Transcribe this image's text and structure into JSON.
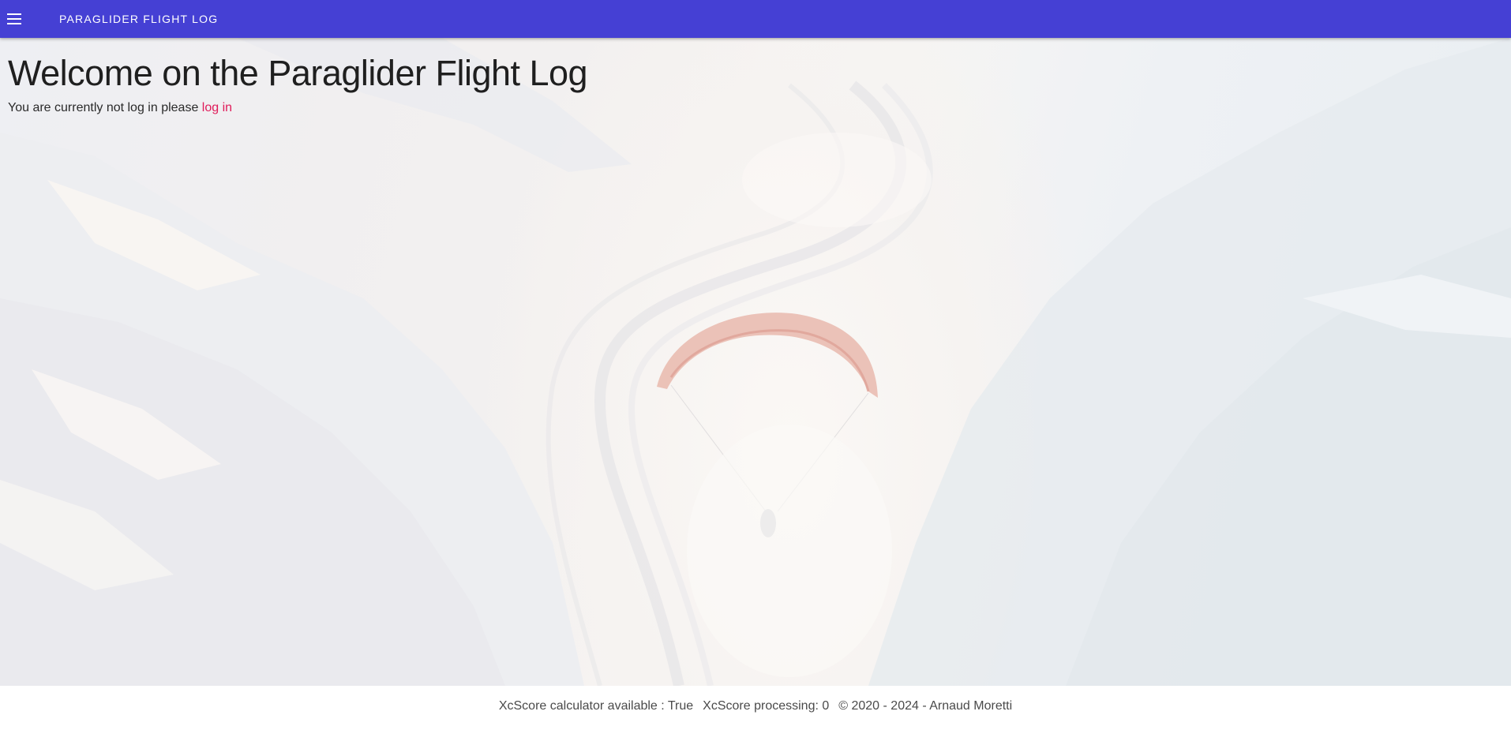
{
  "appbar": {
    "title": "Paraglider Flight Log",
    "menu_icon": "menu-icon",
    "color": "#4540d4"
  },
  "main": {
    "heading": "Welcome on the Paraglider Flight Log",
    "login_prompt": "You are currently not log in please",
    "login_link": "log in",
    "link_color": "#e01a59"
  },
  "footer": {
    "xcscore_available": "XcScore calculator available : True",
    "xcscore_processing": "XcScore processing: 0",
    "copyright": "© 2020 - 2024 - Arnaud Moretti"
  }
}
